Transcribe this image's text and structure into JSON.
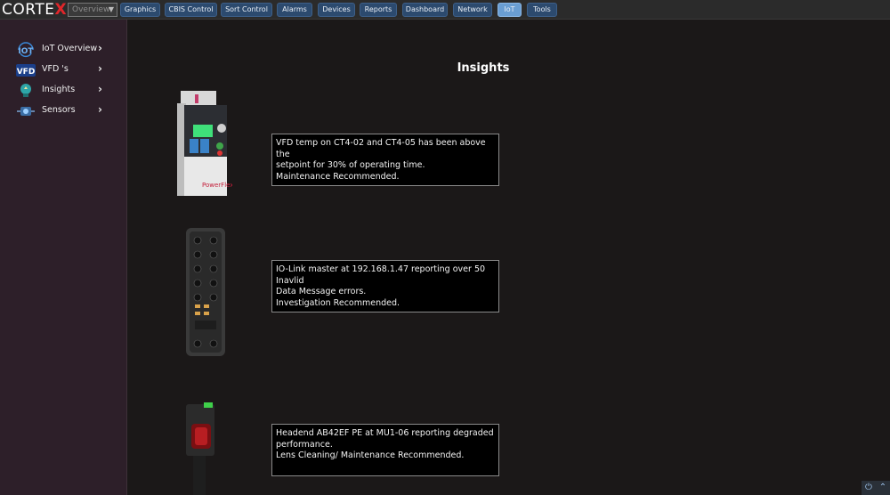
{
  "app": {
    "logo_text": "CORTE",
    "logo_x": "X"
  },
  "topbar": {
    "view_select": "Overview",
    "nav": [
      "Graphics",
      "CBIS Control",
      "Sort Control",
      "Alarms",
      "Devices",
      "Reports",
      "Dashboard",
      "Network",
      "IoT",
      "Tools"
    ],
    "active": "IoT"
  },
  "sidebar": {
    "items": [
      {
        "label": "IoT Overview",
        "icon": "iot-icon"
      },
      {
        "label": "VFD 's",
        "icon": "vfd-icon"
      },
      {
        "label": "Insights",
        "icon": "lightbulb-icon"
      },
      {
        "label": "Sensors",
        "icon": "sensor-icon"
      }
    ]
  },
  "main": {
    "title": "Insights",
    "insights": [
      {
        "device": "vfd-drive-image",
        "lines": [
          "VFD temp on CT4-02 and CT4-05 has been above the",
          "setpoint for 30% of operating time.",
          "Maintenance Recommended."
        ]
      },
      {
        "device": "io-link-master-image",
        "lines": [
          "IO-Link master at 192.168.1.47 reporting over 50 Inavlid",
          "Data Message errors.",
          "Investigation Recommended."
        ]
      },
      {
        "device": "photo-eye-sensor-image",
        "lines": [
          "Headend AB42EF PE at MU1-06 reporting degraded",
          "performance.",
          "Lens Cleaning/ Maintenance Recommended."
        ]
      }
    ]
  },
  "colors": {
    "nav_button": "#2c4a6e",
    "nav_active": "#6a9ed3",
    "sidebar_bg": "#2d1f29",
    "main_bg": "#1b1818",
    "logo_accent": "#e0262a"
  }
}
